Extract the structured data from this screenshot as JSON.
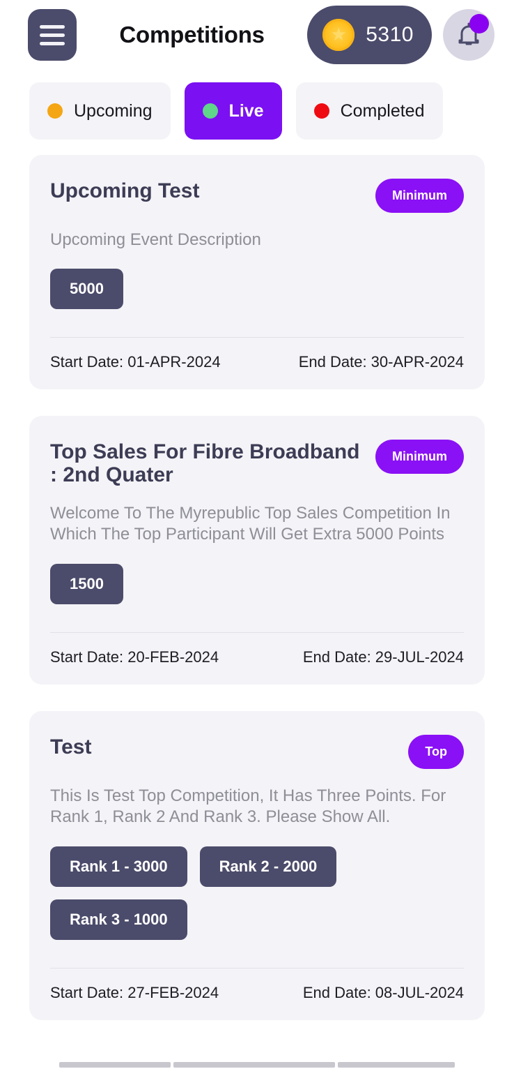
{
  "header": {
    "title": "Competitions",
    "menu_icon": "hamburger-menu-icon",
    "coin_icon": "coin-star-icon",
    "coin_balance": "5310",
    "bell_icon": "bell-notification-icon",
    "accent_purple": "#8a10f5",
    "dark_slate": "#4b4b6b"
  },
  "tabs": [
    {
      "label": "Upcoming",
      "dot_color": "#f5a614",
      "active": false
    },
    {
      "label": "Live",
      "dot_color": "#5fd68a",
      "active": true
    },
    {
      "label": "Completed",
      "dot_color": "#ef0b12",
      "active": false
    }
  ],
  "cards": [
    {
      "title": "Upcoming Test",
      "badge": "Minimum",
      "description": "Upcoming Event Description",
      "points": [
        "5000"
      ],
      "start_label": "Start Date: 01-APR-2024",
      "end_label": "End Date: 30-APR-2024"
    },
    {
      "title": "Top Sales For Fibre Broadband : 2nd Quater",
      "badge": "Minimum",
      "description": "Welcome To The Myrepublic Top Sales Competition In Which The Top Participant Will Get Extra 5000 Points",
      "points": [
        "1500"
      ],
      "start_label": "Start Date: 20-FEB-2024",
      "end_label": "End Date: 29-JUL-2024"
    },
    {
      "title": "Test",
      "badge": "Top",
      "description": "This Is Test Top Competition, It Has Three Points. For Rank 1, Rank 2 And Rank 3. Please Show All.",
      "points": [
        "Rank 1 - 3000",
        "Rank 2 - 2000",
        "Rank 3 - 1000"
      ],
      "start_label": "Start Date: 27-FEB-2024",
      "end_label": "End Date: 08-JUL-2024"
    }
  ]
}
